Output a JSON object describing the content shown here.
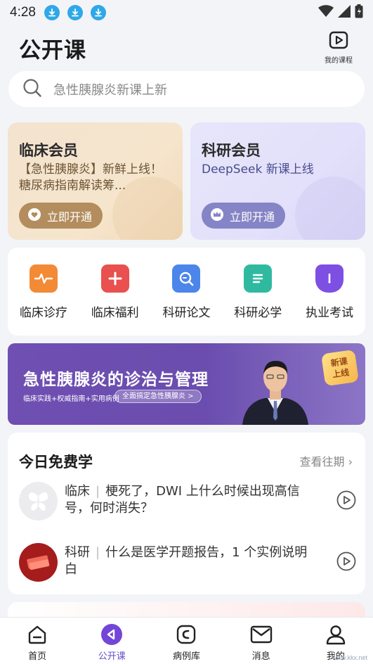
{
  "status_bar": {
    "time": "4:28"
  },
  "header": {
    "title": "公开课",
    "my_courses_label": "我的课程"
  },
  "search": {
    "placeholder": "急性胰腺炎新课上新"
  },
  "member_cards": [
    {
      "title": "临床会员",
      "description": "【急性胰腺炎】新鲜上线！糖尿病指南解读筹...",
      "button_label": "立即开通"
    },
    {
      "title": "科研会员",
      "description": "DeepSeek 新课上线",
      "button_label": "立即开通"
    }
  ],
  "categories": [
    {
      "label": "临床诊疗",
      "icon": "pulse-icon",
      "color": "#f07a2a"
    },
    {
      "label": "临床福利",
      "icon": "plus-icon",
      "color": "#e84a4a"
    },
    {
      "label": "科研论文",
      "icon": "search-doc-icon",
      "color": "#3d7de6"
    },
    {
      "label": "科研必学",
      "icon": "notebook-icon",
      "color": "#27b39a"
    },
    {
      "label": "执业考试",
      "icon": "pen-nib-icon",
      "color": "#7a4be0"
    }
  ],
  "banner": {
    "title": "急性胰腺炎的诊治与管理",
    "tags": "临床实践+权威指南+实用病例",
    "pill": "全面搞定急性胰腺炎 >",
    "badge_line1": "新课",
    "badge_line2": "上线"
  },
  "free_today": {
    "title": "今日免费学",
    "more_label": "查看往期 ›",
    "lessons": [
      {
        "category": "临床",
        "separator": "|",
        "title": "梗死了，DWI 上什么时候出现高信号，何时消失？"
      },
      {
        "category": "科研",
        "separator": "|",
        "title": "什么是医学开题报告，1 个实例说明白"
      }
    ]
  },
  "tabbar": {
    "tabs": [
      {
        "label": "首页",
        "icon": "home-icon"
      },
      {
        "label": "公开课",
        "icon": "play-circle-icon",
        "active": true
      },
      {
        "label": "病例库",
        "icon": "case-library-icon"
      },
      {
        "label": "消息",
        "icon": "mail-icon"
      },
      {
        "label": "我的",
        "icon": "person-icon"
      }
    ]
  },
  "watermark": "www.kkx.net",
  "colors": {
    "accent": "#6a4dc8",
    "download_badge": "#2fa8e8",
    "background": "#f3f4f8"
  }
}
